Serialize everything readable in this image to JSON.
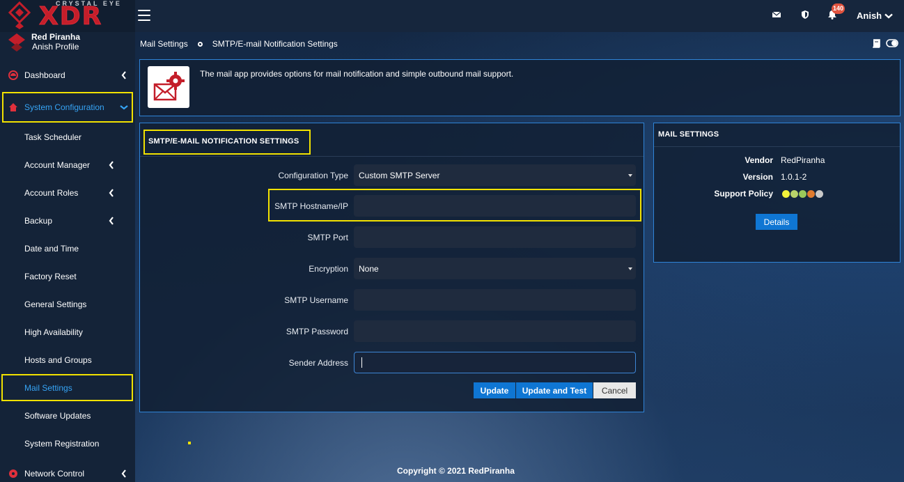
{
  "brand": {
    "logo_top": "CRYSTAL EYE",
    "logo_main": "XDR"
  },
  "profile": {
    "name": "Red Piranha",
    "subtitle": "Anish Profile"
  },
  "sidebar": {
    "items": [
      {
        "label": "Dashboard"
      },
      {
        "label": "System Configuration"
      },
      {
        "label": "Task Scheduler"
      },
      {
        "label": "Account Manager"
      },
      {
        "label": "Account Roles"
      },
      {
        "label": "Backup"
      },
      {
        "label": "Date and Time"
      },
      {
        "label": "Factory Reset"
      },
      {
        "label": "General Settings"
      },
      {
        "label": "High Availability"
      },
      {
        "label": "Hosts and Groups"
      },
      {
        "label": "Mail Settings"
      },
      {
        "label": "Software Updates"
      },
      {
        "label": "System Registration"
      },
      {
        "label": "Network Control"
      }
    ]
  },
  "topbar": {
    "notification_count": "140",
    "user_name": "Anish"
  },
  "breadcrumb": {
    "parent": "Mail Settings",
    "current": "SMTP/E-mail Notification Settings"
  },
  "info": {
    "description": "The mail app provides options for mail notification and simple outbound mail support."
  },
  "form": {
    "title": "SMTP/E-MAIL NOTIFICATION SETTINGS",
    "fields": {
      "config_type": {
        "label": "Configuration Type",
        "value": "Custom SMTP Server"
      },
      "hostname": {
        "label": "SMTP Hostname/IP",
        "value": ""
      },
      "port": {
        "label": "SMTP Port",
        "value": ""
      },
      "encryption": {
        "label": "Encryption",
        "value": "None"
      },
      "username": {
        "label": "SMTP Username",
        "value": ""
      },
      "password": {
        "label": "SMTP Password",
        "value": ""
      },
      "sender": {
        "label": "Sender Address",
        "value": ""
      }
    },
    "buttons": {
      "update": "Update",
      "update_test": "Update and Test",
      "cancel": "Cancel"
    }
  },
  "mail_settings": {
    "title": "MAIL SETTINGS",
    "vendor_label": "Vendor",
    "vendor": "RedPiranha",
    "version_label": "Version",
    "version": "1.0.1-2",
    "support_label": "Support Policy",
    "support_colors": [
      "#f2f23a",
      "#b8d36a",
      "#9bc85a",
      "#e07b2e",
      "#c9c9c9"
    ],
    "details_button": "Details"
  },
  "footer": {
    "copyright": "Copyright © 2021 RedPiranha"
  },
  "colors": {
    "accent": "#0f76d3",
    "highlight": "#f2e200",
    "brand_red": "#c41e2a"
  }
}
